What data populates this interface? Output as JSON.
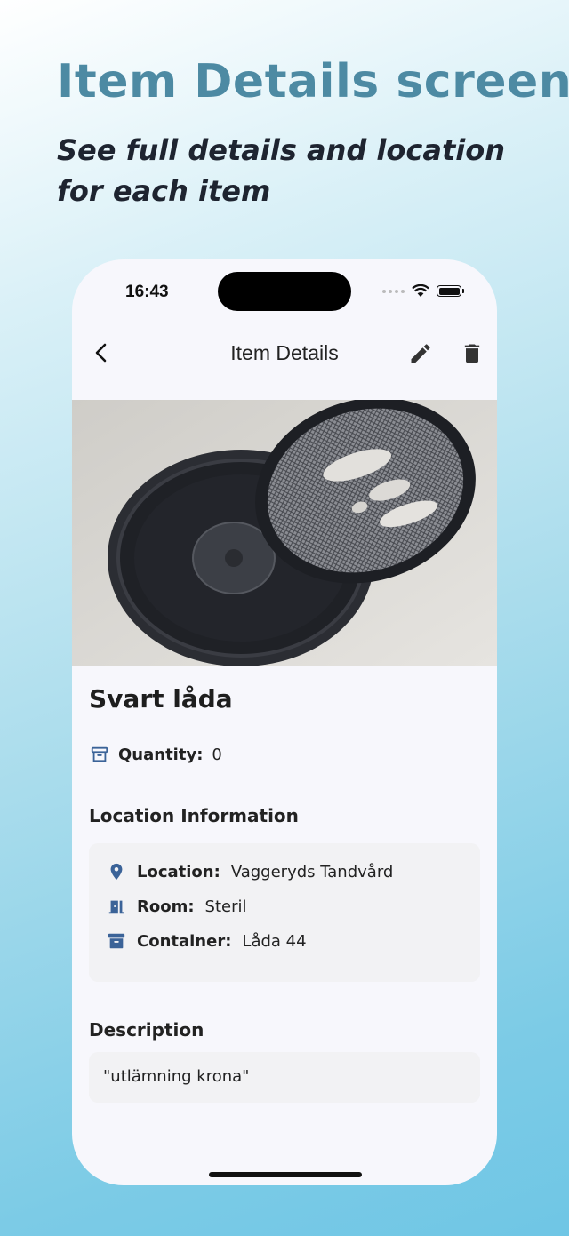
{
  "promo": {
    "headline": "Item Details screen",
    "subhead": "See full details and location for each item"
  },
  "status_bar": {
    "time": "16:43"
  },
  "nav": {
    "title": "Item Details",
    "back_icon": "chevron-left-icon",
    "edit_icon": "pencil-icon",
    "delete_icon": "trash-icon"
  },
  "item": {
    "name": "Svart låda",
    "quantity_label": "Quantity:",
    "quantity_value": "0"
  },
  "location_section": {
    "heading": "Location Information",
    "location_label": "Location:",
    "location_value": "Vaggeryds Tandvård",
    "room_label": "Room:",
    "room_value": "Steril",
    "container_label": "Container:",
    "container_value": "Låda 44"
  },
  "description_section": {
    "heading": "Description",
    "text": "\"utlämning krona\""
  },
  "colors": {
    "accent": "#3b6398",
    "headline": "#4d8aa3"
  }
}
